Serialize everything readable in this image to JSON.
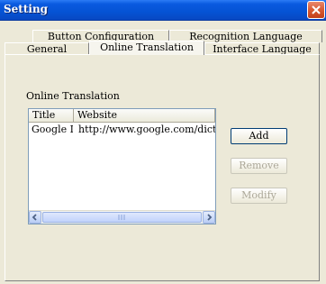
{
  "window": {
    "title": "Setting"
  },
  "tabs": {
    "row1": [
      "Button Configuration",
      "Recognition Language"
    ],
    "row2": [
      "General",
      "Online Translation",
      "Interface Language"
    ],
    "active": "Online Translation"
  },
  "section": {
    "label": "Online Translation"
  },
  "table": {
    "columns": [
      "Title",
      "Website"
    ],
    "rows": [
      {
        "title": "Google D...",
        "website": "http://www.google.com/dictionary"
      }
    ]
  },
  "buttons": {
    "add": "Add",
    "remove": "Remove",
    "modify": "Modify"
  },
  "colors": {
    "titlebar": "#0553d4",
    "close": "#d85a33",
    "face": "#ece9d8"
  }
}
